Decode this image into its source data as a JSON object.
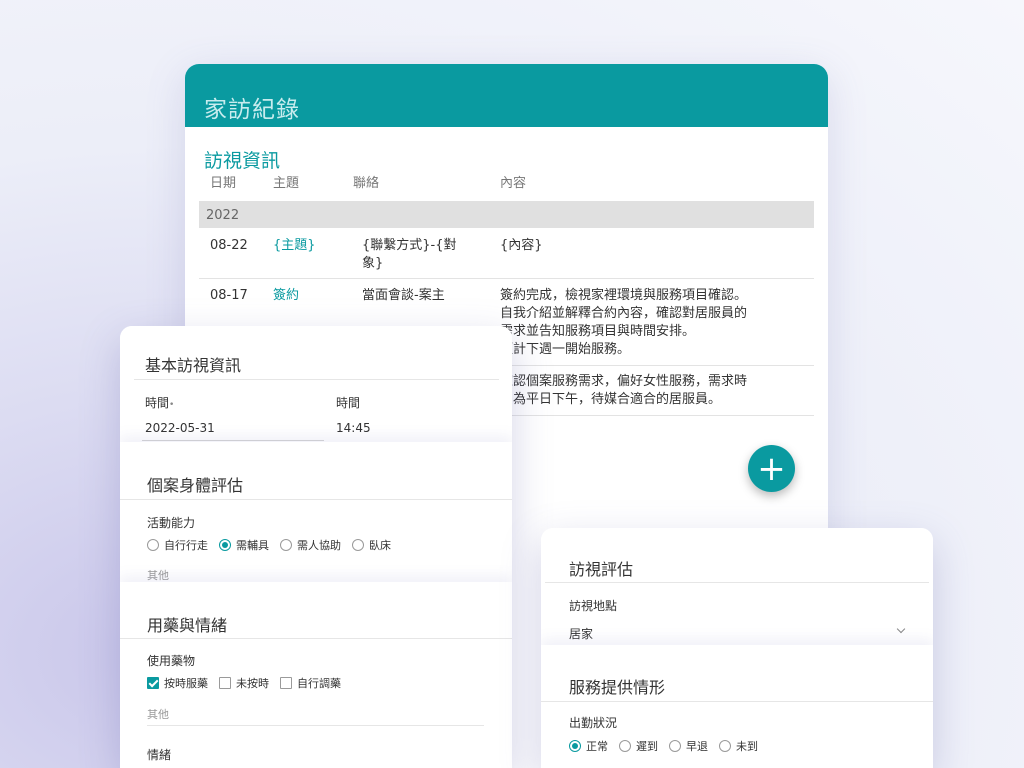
{
  "visit_record": {
    "title": "家訪紀錄",
    "section_title": "訪視資訊",
    "columns": [
      "日期",
      "主題",
      "聯絡",
      "內容"
    ],
    "year_group": "2022",
    "rows": [
      {
        "date": "08-22",
        "topic": "{主題}",
        "contact": "{聯繫方式}-{對\n象}",
        "content": "{內容}"
      },
      {
        "date": "08-17",
        "topic": "簽約",
        "contact": "當面會談-案主",
        "content": "簽約完成，檢視家裡環境與服務項目確認。\n自我介紹並解釋合約內容，確認對居服員的\n需求並告知服務項目與時間安排。\n預計下週一開始服務。"
      },
      {
        "date": "",
        "topic": "",
        "contact": "",
        "content": "確認個案服務需求，偏好女性服務，需求時\n間為平日下午，待媒合適合的居服員。"
      }
    ],
    "fab_icon": "plus-icon"
  },
  "basic_info_form": {
    "title": "基本訪視資訊",
    "date_label": "時間",
    "required_mark": "•",
    "date_value": "2022-05-31",
    "time_label": "時間",
    "time_value": "14:45"
  },
  "physical_assessment": {
    "title": "個案身體評估",
    "mobility_label": "活動能力",
    "mobility_options": [
      "自行行走",
      "需輔具",
      "需人協助",
      "臥床"
    ],
    "mobility_selected": "需輔具",
    "other_placeholder": "其他"
  },
  "medication_mood": {
    "title": "用藥與情緒",
    "medication_label": "使用藥物",
    "medication_options": [
      "按時服藥",
      "未按時",
      "自行調藥"
    ],
    "medication_checked": [
      "按時服藥"
    ],
    "other_placeholder": "其他",
    "mood_label": "情緒"
  },
  "visit_evaluation": {
    "title": "訪視評估",
    "location_label": "訪視地點",
    "location_value": "居家"
  },
  "service_status": {
    "title": "服務提供情形",
    "attendance_label": "出勤狀況",
    "attendance_options": [
      "正常",
      "遲到",
      "早退",
      "未到"
    ],
    "attendance_selected": "正常"
  },
  "colors": {
    "accent": "#0a9aa0",
    "header_text": "#c8ecee",
    "year_bar": "#e0e0e0"
  }
}
